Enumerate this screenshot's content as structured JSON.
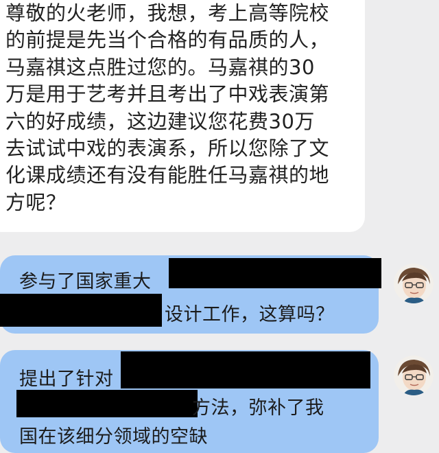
{
  "incoming_message": {
    "lines": [
      "尊敬的火老师，我想，考上高等院校",
      "的前提是先当个合格的有品质的人，",
      "马嘉祺这点胜过您的。马嘉祺的30",
      "万是用于艺考并且考出了中戏表演第",
      "六的好成绩，这边建议您花费30万",
      "去试试中戏的表演系，所以您除了文",
      "化课成绩还有没有能胜任马嘉祺的地",
      "方呢？"
    ]
  },
  "reply_1": {
    "line_1": "参与了国家重大",
    "line_2": "设计工作，这算吗？"
  },
  "reply_2": {
    "line_1": "提出了针对",
    "line_2": "方法，弥补了我",
    "line_3": "国在该细分领域的空缺"
  },
  "colors": {
    "background": "#ededee",
    "incoming_bubble": "#ffffff",
    "outgoing_bubble": "#9ec6f5",
    "redaction": "#000000"
  },
  "icons": {
    "avatar": "user-avatar-photo"
  }
}
